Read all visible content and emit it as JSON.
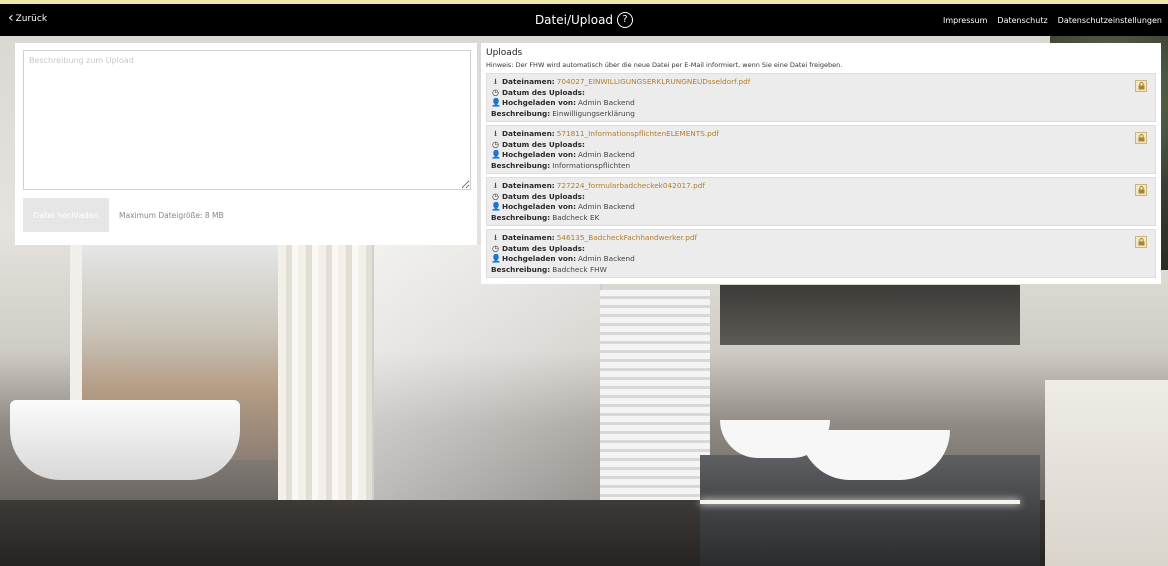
{
  "topbar": {
    "back_label": "Zurück",
    "title": "Datei/Upload",
    "nav": [
      "Impressum",
      "Datenschutz",
      "Datenschutzeinstellungen"
    ]
  },
  "upload_form": {
    "description_placeholder": "Beschreibung zum Upload",
    "description_value": "",
    "select_button_label": "Datei hochladen",
    "max_size_text": "Maximum Dateigröße: 8 MB"
  },
  "uploads": {
    "title": "Uploads",
    "hint": "Hinweis: Der FHW wird automatisch über die neue Datei per E-Mail informiert, wenn Sie eine Datei freigeben.",
    "labels": {
      "filename": "Dateinamen:",
      "date": "Datum des Uploads:",
      "uploaded_by": "Hochgeladen von:",
      "description": "Beschreibung:"
    },
    "items": [
      {
        "filename": "704027_EINWILLIGUNGSERKLRUNGNEUDsseldorf.pdf",
        "date": "",
        "uploaded_by": "Admin Backend",
        "description": "Einwilligungserklärung"
      },
      {
        "filename": "571811_InformationspflichtenELEMENTS.pdf",
        "date": "",
        "uploaded_by": "Admin Backend",
        "description": "Informationspflichten"
      },
      {
        "filename": "727224_formularbadcheckek042017.pdf",
        "date": "",
        "uploaded_by": "Admin Backend",
        "description": "Badcheck EK"
      },
      {
        "filename": "546135_BadcheckFachhandwerker.pdf",
        "date": "",
        "uploaded_by": "Admin Backend",
        "description": "Badcheck FHW"
      }
    ]
  },
  "colors": {
    "topbar_bg": "#000000",
    "accent_stripe": "#f2e7a8",
    "link": "#b27d2a",
    "item_bg": "#ececec"
  },
  "icons": {
    "back": "chevron-left-icon",
    "help": "help-circle-icon",
    "file": "upload-icon",
    "date": "clock-icon",
    "user": "user-icon",
    "lock": "lock-icon"
  }
}
